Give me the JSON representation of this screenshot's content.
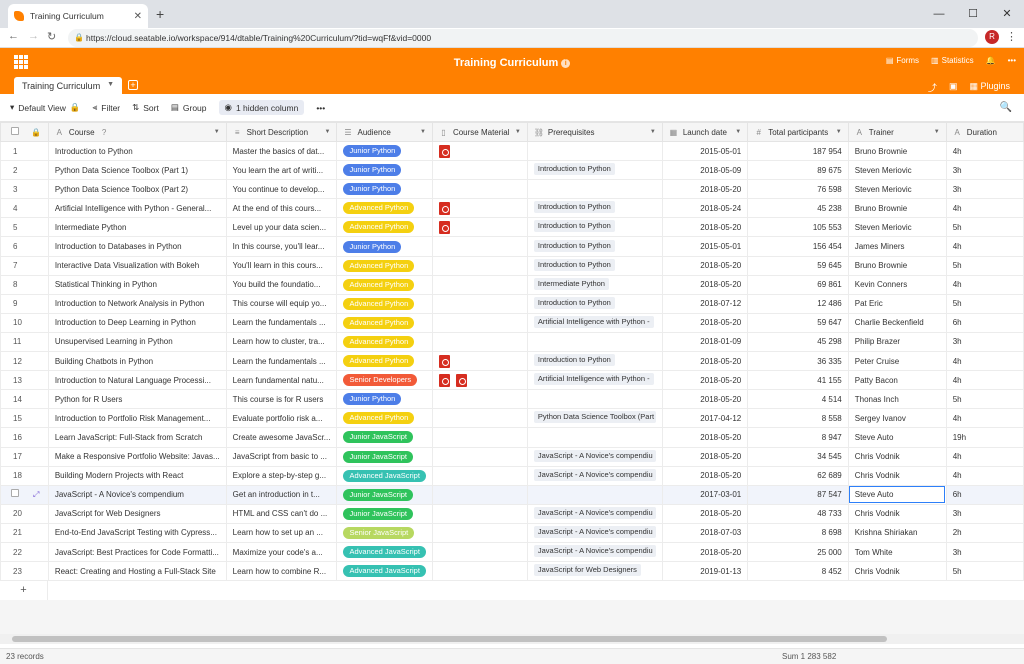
{
  "browser": {
    "tab_title": "Training Curriculum",
    "url": "https://cloud.seatable.io/workspace/914/dtable/Training%20Curriculum/?tid=wqFf&vid=0000",
    "avatar_letter": "R"
  },
  "header": {
    "title": "Training Curriculum",
    "forms_label": "Forms",
    "statistics_label": "Statistics",
    "plugins_label": "Plugins",
    "table_tab": "Training Curriculum"
  },
  "toolbar": {
    "view": "Default View",
    "filter": "Filter",
    "sort": "Sort",
    "group": "Group",
    "hidden": "1 hidden column"
  },
  "columns": [
    "Course",
    "Short Description",
    "Audience",
    "Course Material",
    "Prerequisites",
    "Launch date",
    "Total participants",
    "Trainer",
    "Duration"
  ],
  "audience_colors": {
    "Junior Python": "#4d7ee8",
    "Advanced Python": "#f4d010",
    "Senior Developers": "#f25a38",
    "Junior JavaScript": "#2fc35c",
    "Advanced JavaScript": "#36c1b2",
    "Senior JavaScript": "#b7d860"
  },
  "rows": [
    {
      "n": "1",
      "course": "Introduction to Python",
      "desc": "Master the basics of dat...",
      "aud": "Junior Python",
      "mat": "pdf",
      "pre": "",
      "date": "2015-05-01",
      "part": "187 954",
      "trainer": "Bruno Brownie",
      "dur": "4h"
    },
    {
      "n": "2",
      "course": "Python Data Science Toolbox (Part 1)",
      "desc": "You learn the art of writi...",
      "aud": "Junior Python",
      "mat": "",
      "pre": "Introduction to Python",
      "date": "2018-05-09",
      "part": "89 675",
      "trainer": "Steven Meriovic",
      "dur": "3h"
    },
    {
      "n": "3",
      "course": "Python Data Science Toolbox (Part 2)",
      "desc": "You continue to develop...",
      "aud": "Junior Python",
      "mat": "",
      "pre": "",
      "date": "2018-05-20",
      "part": "76 598",
      "trainer": "Steven Meriovic",
      "dur": "3h"
    },
    {
      "n": "4",
      "course": "Artificial Intelligence with Python - General...",
      "desc": "At the end of this cours...",
      "aud": "Advanced Python",
      "mat": "pdf",
      "pre": "Introduction to Python",
      "date": "2018-05-24",
      "part": "45 238",
      "trainer": "Bruno Brownie",
      "dur": "4h"
    },
    {
      "n": "5",
      "course": "Intermediate Python",
      "desc": "Level up your data scien...",
      "aud": "Advanced Python",
      "mat": "pdf",
      "pre": "Introduction to Python",
      "date": "2018-05-20",
      "part": "105 553",
      "trainer": "Steven Meriovic",
      "dur": "5h"
    },
    {
      "n": "6",
      "course": "Introduction to Databases in Python",
      "desc": "In this course, you'll lear...",
      "aud": "Junior Python",
      "mat": "",
      "pre": "Introduction to Python",
      "date": "2015-05-01",
      "part": "156 454",
      "trainer": "James Miners",
      "dur": "4h"
    },
    {
      "n": "7",
      "course": "Interactive Data Visualization with Bokeh",
      "desc": "You'll learn in this cours...",
      "aud": "Advanced Python",
      "mat": "",
      "pre": "Introduction to Python",
      "date": "2018-05-20",
      "part": "59 645",
      "trainer": "Bruno Brownie",
      "dur": "5h"
    },
    {
      "n": "8",
      "course": "Statistical Thinking in Python",
      "desc": "You build the foundatio...",
      "aud": "Advanced Python",
      "mat": "",
      "pre": "Intermediate Python",
      "date": "2018-05-20",
      "part": "69 861",
      "trainer": "Kevin Conners",
      "dur": "4h"
    },
    {
      "n": "9",
      "course": "Introduction to Network Analysis in Python",
      "desc": "This course will equip yo...",
      "aud": "Advanced Python",
      "mat": "",
      "pre": "Introduction to Python",
      "date": "2018-07-12",
      "part": "12 486",
      "trainer": "Pat Eric",
      "dur": "5h"
    },
    {
      "n": "10",
      "course": "Introduction to Deep Learning in Python",
      "desc": "Learn the fundamentals ...",
      "aud": "Advanced Python",
      "mat": "",
      "pre": "Artificial Intelligence with Python -",
      "date": "2018-05-20",
      "part": "59 647",
      "trainer": "Charlie Beckenfield",
      "dur": "6h"
    },
    {
      "n": "11",
      "course": "Unsupervised Learning in Python",
      "desc": "Learn how to cluster, tra...",
      "aud": "Advanced Python",
      "mat": "",
      "pre": "",
      "date": "2018-01-09",
      "part": "45 298",
      "trainer": "Philip Brazer",
      "dur": "3h"
    },
    {
      "n": "12",
      "course": "Building Chatbots in Python",
      "desc": "Learn the fundamentals ...",
      "aud": "Advanced Python",
      "mat": "pdf",
      "pre": "Introduction to Python",
      "date": "2018-05-20",
      "part": "36 335",
      "trainer": "Peter Cruise",
      "dur": "4h"
    },
    {
      "n": "13",
      "course": "Introduction to Natural Language Processi...",
      "desc": "Learn fundamental natu...",
      "aud": "Senior Developers",
      "mat": "pdf2",
      "pre": "Artificial Intelligence with Python -",
      "date": "2018-05-20",
      "part": "41 155",
      "trainer": "Patty Bacon",
      "dur": "4h"
    },
    {
      "n": "14",
      "course": "Python for R Users",
      "desc": "This course is for R users",
      "aud": "Junior Python",
      "mat": "",
      "pre": "",
      "date": "2018-05-20",
      "part": "4 514",
      "trainer": "Thonas Inch",
      "dur": "5h"
    },
    {
      "n": "15",
      "course": "Introduction to Portfolio Risk Management...",
      "desc": "Evaluate portfolio risk a...",
      "aud": "Advanced Python",
      "mat": "",
      "pre": "Python Data Science Toolbox (Part",
      "date": "2017-04-12",
      "part": "8 558",
      "trainer": "Sergey Ivanov",
      "dur": "4h"
    },
    {
      "n": "16",
      "course": "Learn JavaScript: Full-Stack from Scratch",
      "desc": "Create awesome JavaScr...",
      "aud": "Junior JavaScript",
      "mat": "",
      "pre": "",
      "date": "2018-05-20",
      "part": "8 947",
      "trainer": "Steve Auto",
      "dur": "19h"
    },
    {
      "n": "17",
      "course": "Make a Responsive Portfolio Website: Javas...",
      "desc": "JavaScript from basic to ...",
      "aud": "Junior JavaScript",
      "mat": "",
      "pre": "JavaScript - A Novice's compendiu",
      "date": "2018-05-20",
      "part": "34 545",
      "trainer": "Chris Vodnik",
      "dur": "4h"
    },
    {
      "n": "18",
      "course": "Building Modern Projects with React",
      "desc": "Explore a step-by-step g...",
      "aud": "Advanced JavaScript",
      "mat": "",
      "pre": "JavaScript - A Novice's compendiu",
      "date": "2018-05-20",
      "part": "62 689",
      "trainer": "Chris Vodnik",
      "dur": "4h"
    },
    {
      "n": "",
      "course": "JavaScript - A Novice's compendium",
      "desc": "Get an introduction in t...",
      "aud": "Junior JavaScript",
      "mat": "",
      "pre": "",
      "date": "2017-03-01",
      "part": "87 547",
      "trainer": "Steve Auto",
      "dur": "6h"
    },
    {
      "n": "20",
      "course": "JavaScript for Web Designers",
      "desc": "HTML and CSS can't do ...",
      "aud": "Junior JavaScript",
      "mat": "",
      "pre": "JavaScript - A Novice's compendiu",
      "date": "2018-05-20",
      "part": "48 733",
      "trainer": "Chris Vodnik",
      "dur": "3h"
    },
    {
      "n": "21",
      "course": "End-to-End JavaScript Testing with Cypress...",
      "desc": "Learn how to set up an ...",
      "aud": "Senior JavaScript",
      "mat": "",
      "pre": "JavaScript - A Novice's compendiu",
      "date": "2018-07-03",
      "part": "8 698",
      "trainer": "Krishna Shiriakan",
      "dur": "2h"
    },
    {
      "n": "22",
      "course": "JavaScript: Best Practices for Code Formatti...",
      "desc": "Maximize your code's a...",
      "aud": "Advanced JavaScript",
      "mat": "",
      "pre": "JavaScript - A Novice's compendiu",
      "date": "2018-05-20",
      "part": "25 000",
      "trainer": "Tom White",
      "dur": "3h"
    },
    {
      "n": "23",
      "course": "React: Creating and Hosting a Full-Stack Site",
      "desc": "Learn how to combine R...",
      "aud": "Advanced JavaScript",
      "mat": "",
      "pre": "JavaScript for Web Designers",
      "date": "2019-01-13",
      "part": "8 452",
      "trainer": "Chris Vodnik",
      "dur": "5h"
    }
  ],
  "status": {
    "records": "23 records",
    "sum": "Sum 1 283 582"
  }
}
